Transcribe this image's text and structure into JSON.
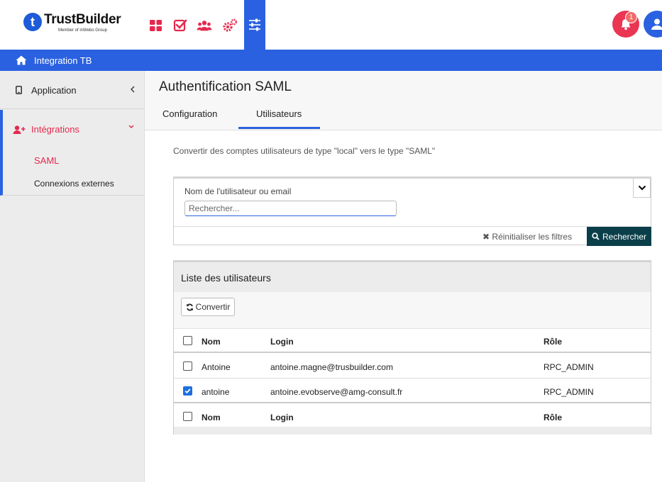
{
  "brand": {
    "name": "TrustBuilder",
    "logo_letter": "t",
    "tagline": "Member of inWebo Group",
    "primary_color": "#2a61e0",
    "accent_color": "#e5294e"
  },
  "topnav": {
    "icons": [
      "grid-icon",
      "checkbox-icon",
      "users-icon",
      "cogs-icon",
      "sliders-icon"
    ],
    "active": "sliders-icon"
  },
  "notifications": {
    "count": "1"
  },
  "context_bar": {
    "title": "Integration TB"
  },
  "sidebar": {
    "application": {
      "label": "Application"
    },
    "integrations": {
      "label": "Intégrations",
      "children": [
        {
          "label": "SAML",
          "active": true
        },
        {
          "label": "Connexions externes",
          "active": false
        }
      ]
    }
  },
  "page": {
    "title": "Authentification SAML",
    "tabs": [
      {
        "label": "Configuration",
        "active": false
      },
      {
        "label": "Utilisateurs",
        "active": true
      }
    ],
    "description": "Convertir des comptes utilisateurs de type \"local\" vers le type \"SAML\""
  },
  "filter": {
    "label": "Nom de l'utilisateur ou email",
    "placeholder": "Rechercher...",
    "reset_label": "Réinitialiser les filtres",
    "search_label": "Rechercher"
  },
  "users": {
    "title": "Liste des utilisateurs",
    "convert_label": "Convertir",
    "columns": [
      "Nom",
      "Login",
      "Rôle"
    ],
    "rows": [
      {
        "name": "Antoine",
        "login": "antoine.magne@trusbuilder.com",
        "role": "RPC_ADMIN",
        "checked": false
      },
      {
        "name": "antoine",
        "login": "antoine.evobserve@amg-consult.fr",
        "role": "RPC_ADMIN",
        "checked": true
      }
    ]
  }
}
